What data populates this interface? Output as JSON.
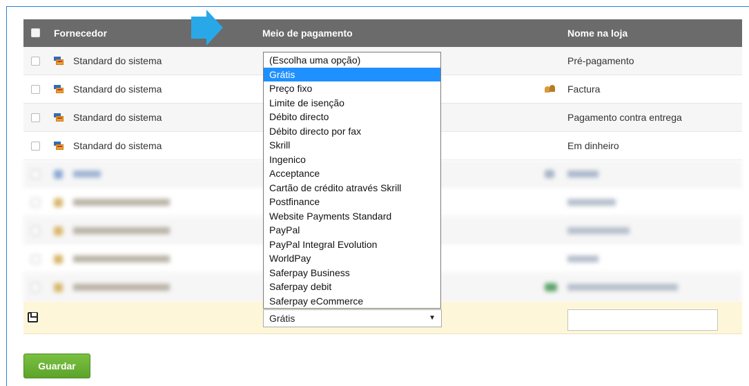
{
  "table": {
    "headers": {
      "provider": "Fornecedor",
      "payment": "Meio de pagamento",
      "store_name": "Nome na loja"
    },
    "rows": [
      {
        "provider": "Standard do sistema",
        "store_name": "Pré-pagamento",
        "store_icon": ""
      },
      {
        "provider": "Standard do sistema",
        "store_name": "Factura",
        "store_icon": "people-icon"
      },
      {
        "provider": "Standard do sistema",
        "store_name": "Pagamento contra entrega",
        "store_icon": ""
      },
      {
        "provider": "Standard do sistema",
        "store_name": "Em dinheiro",
        "store_icon": ""
      }
    ]
  },
  "edit_row": {
    "selected_payment": "Grátis",
    "store_name_value": ""
  },
  "dropdown": {
    "options": [
      "(Escolha uma opção)",
      "Grátis",
      "Preço fixo",
      "Limite de isenção",
      "Débito directo",
      "Débito directo por fax",
      "Skrill",
      "Ingenico",
      "Acceptance",
      "Cartão de crédito através Skrill",
      "Postfinance",
      "Website Payments Standard",
      "PayPal",
      "PayPal Integral Evolution",
      "WorldPay",
      "Saferpay Business",
      "Saferpay debit",
      "Saferpay eCommerce"
    ],
    "highlighted": "Grátis"
  },
  "buttons": {
    "save": "Guardar"
  },
  "colors": {
    "header_bg": "#6b6b6b",
    "highlight": "#1e90ff",
    "save_button": "#6ab236",
    "edit_row_bg": "#fdf6d8",
    "arrow": "#29a8e8"
  }
}
